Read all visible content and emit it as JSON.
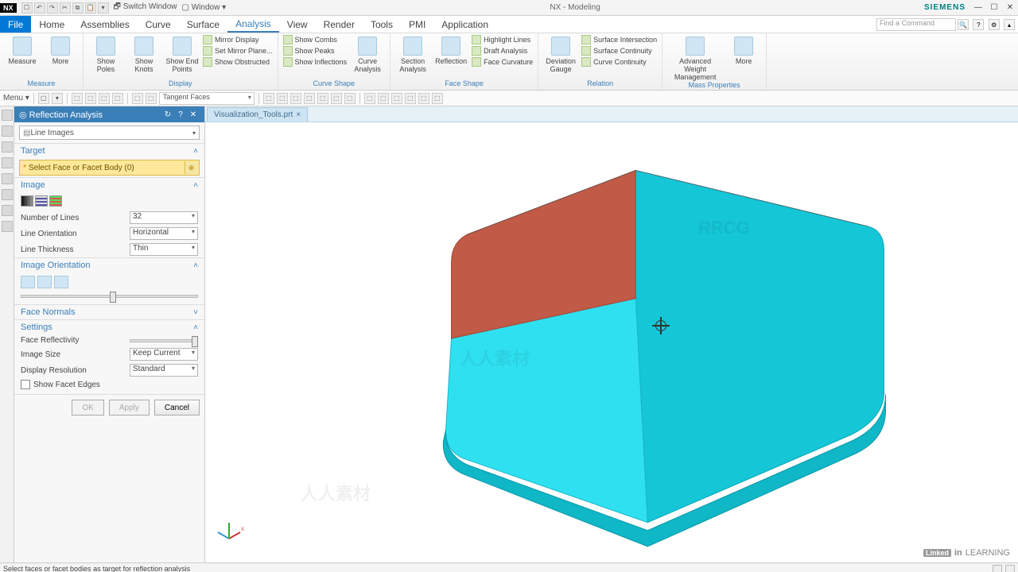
{
  "title_bar": {
    "app": "NX",
    "switch_window": "Switch Window",
    "window_menu": "Window",
    "center_title": "NX - Modeling",
    "brand": "SIEMENS"
  },
  "menu": {
    "file": "File",
    "items": [
      "Home",
      "Assemblies",
      "Curve",
      "Surface",
      "Analysis",
      "View",
      "Render",
      "Tools",
      "PMI",
      "Application"
    ],
    "active_index": 4,
    "search_placeholder": "Find a Command"
  },
  "ribbon": {
    "groups": [
      {
        "label": "Measure",
        "big": [
          {
            "label": "Measure"
          },
          {
            "label": "More"
          }
        ]
      },
      {
        "label": "Display",
        "big": [
          {
            "label": "Show\nPoles"
          },
          {
            "label": "Show\nKnots"
          },
          {
            "label": "Show End\nPoints"
          }
        ],
        "col": [
          "Mirror Display",
          "Set Mirror Plane...",
          "Show Obstructed"
        ]
      },
      {
        "label": "Curve Shape",
        "col": [
          "Show Combs",
          "Show Peaks",
          "Show Inflections"
        ],
        "big": [
          {
            "label": "Curve\nAnalysis"
          }
        ]
      },
      {
        "label": "Face Shape",
        "big": [
          {
            "label": "Section\nAnalysis"
          },
          {
            "label": "Reflection"
          }
        ],
        "col": [
          "Highlight Lines",
          "Draft Analysis",
          "Face Curvature"
        ]
      },
      {
        "label": "Relation",
        "big": [
          {
            "label": "Deviation\nGauge"
          }
        ],
        "col": [
          "Surface Intersection",
          "Surface Continuity",
          "Curve Continuity"
        ]
      },
      {
        "label": "Mass Properties",
        "big": [
          {
            "label": "Advanced Weight\nManagement"
          },
          {
            "label": "More"
          }
        ]
      }
    ]
  },
  "toolbar2": {
    "menu": "Menu",
    "filter": "Tangent Faces"
  },
  "doc_tab": "Visualization_Tools.prt",
  "panel": {
    "title": "Reflection Analysis",
    "type_value": "Line Images",
    "sections": {
      "target": "Target",
      "select_face": "Select Face or Facet Body (0)",
      "image": "Image",
      "num_lines_label": "Number of Lines",
      "num_lines_value": "32",
      "line_orient_label": "Line Orientation",
      "line_orient_value": "Horizontal",
      "line_thick_label": "Line Thickness",
      "line_thick_value": "Thin",
      "image_orient": "Image Orientation",
      "face_normals": "Face Normals",
      "settings": "Settings",
      "face_reflect_label": "Face Reflectivity",
      "image_size_label": "Image Size",
      "image_size_value": "Keep Current",
      "disp_res_label": "Display Resolution",
      "disp_res_value": "Standard",
      "show_facet": "Show Facet Edges"
    },
    "buttons": {
      "ok": "OK",
      "apply": "Apply",
      "cancel": "Cancel"
    }
  },
  "status": "Select faces or facet bodies as target for reflection analysis",
  "branding": {
    "linkedin": "Linked",
    "learning": "LEARNING"
  }
}
